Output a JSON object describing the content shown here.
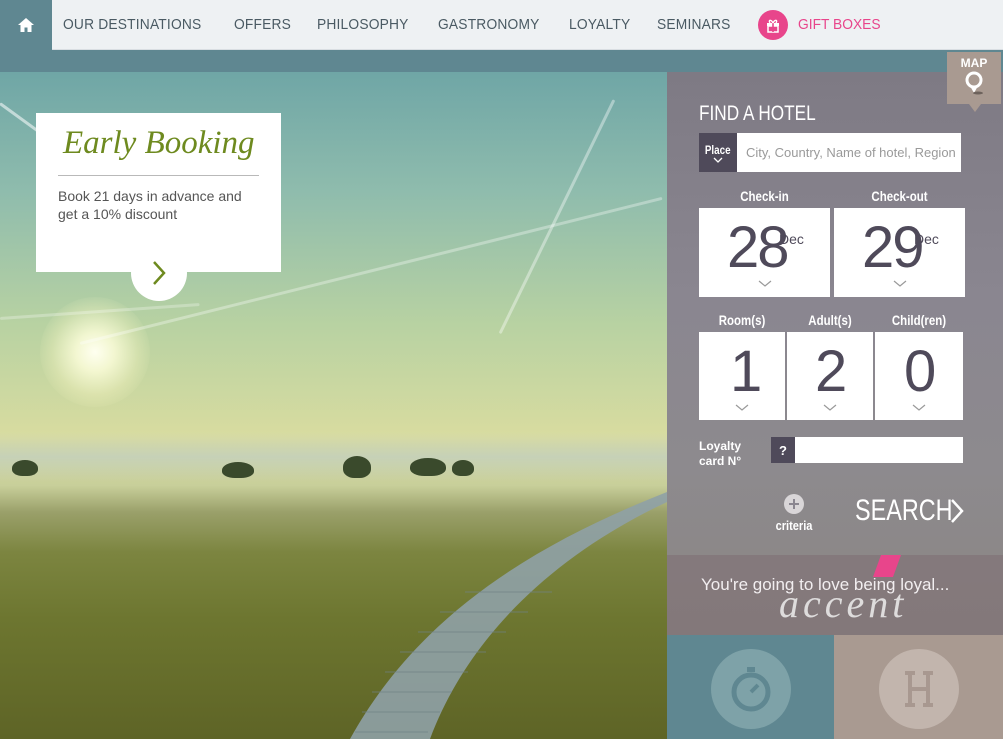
{
  "nav": {
    "items": [
      "OUR DESTINATIONS",
      "OFFERS",
      "PHILOSOPHY",
      "GASTRONOMY",
      "LOYALTY",
      "SEMINARS"
    ],
    "gift_label": "GIFT BOXES"
  },
  "promo": {
    "title": "Early Booking",
    "text": "Book 21 days in advance and get a 10% discount"
  },
  "map": {
    "label": "MAP"
  },
  "search": {
    "title": "FIND A HOTEL",
    "place_button": "Place",
    "place_placeholder": "City, Country, Name of hotel, Region",
    "checkin_label": "Check-in",
    "checkout_label": "Check-out",
    "checkin_day": "28",
    "checkin_month": "Dec",
    "checkout_day": "29",
    "checkout_month": "Dec",
    "rooms_label": "Room(s)",
    "adults_label": "Adult(s)",
    "children_label": "Child(ren)",
    "rooms_value": "1",
    "adults_value": "2",
    "children_value": "0",
    "loyalty_line1": "Loyalty",
    "loyalty_line2": "card N°",
    "loyalty_help": "?",
    "criteria_label": "criteria",
    "search_label": "SEARCH"
  },
  "loyalty_promo": {
    "text": "You're going to love being loyal...",
    "brand": "accent"
  },
  "colors": {
    "teal": "#5f8791",
    "pink": "#e8458b",
    "taupe": "#a99a91",
    "panel": "#8a8690",
    "dark": "#4f4a5a",
    "olive": "#6e8a1f"
  }
}
